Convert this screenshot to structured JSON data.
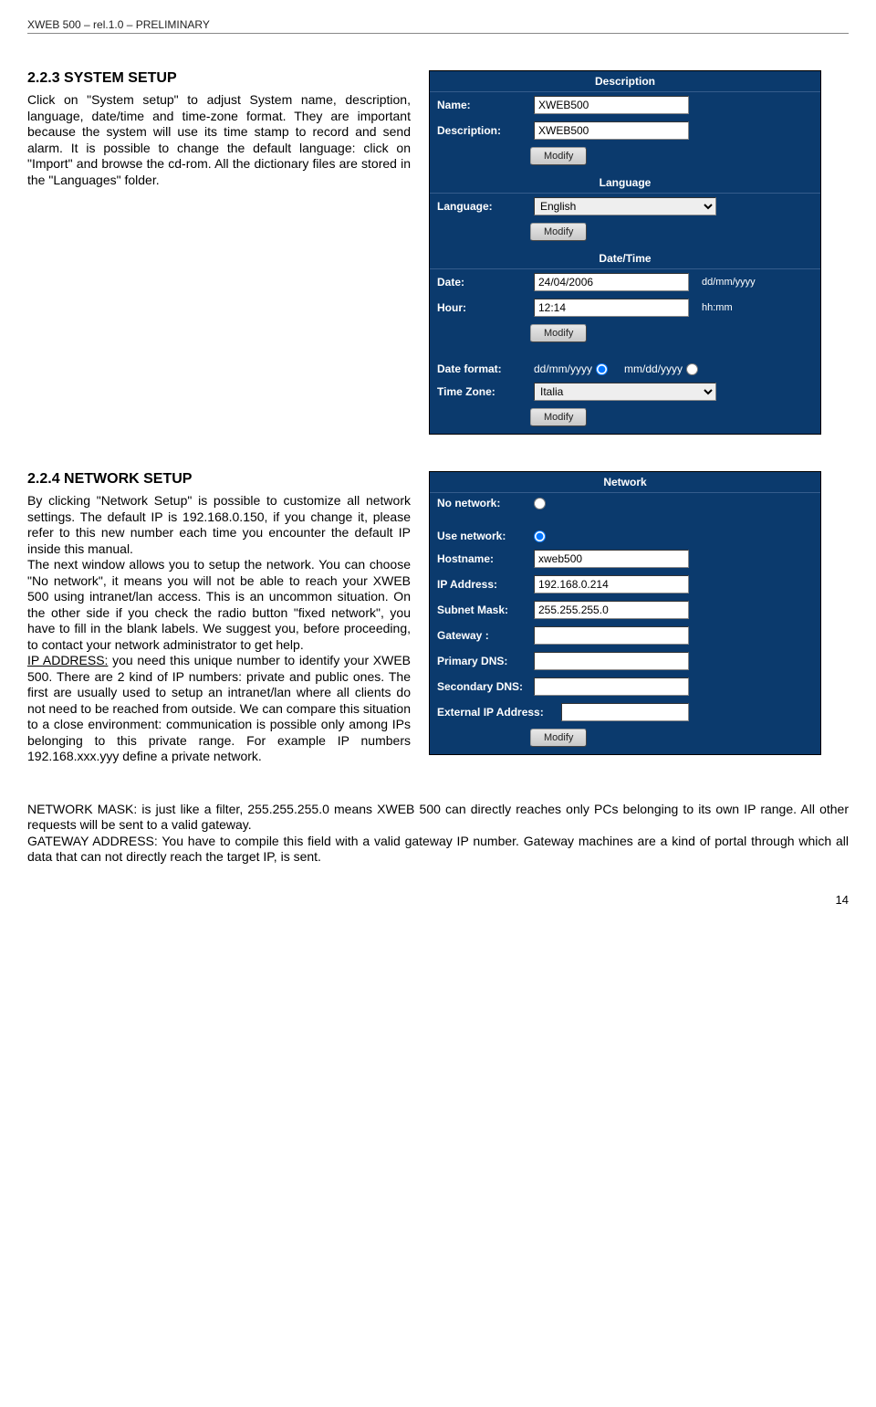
{
  "header": "XWEB 500 – rel.1.0 – PRELIMINARY",
  "page_num": "14",
  "section1": {
    "title": "2.2.3  SYSTEM SETUP",
    "body": "Click on \"System setup\" to adjust System name, description, language, date/time and time-zone format. They are important because the system will use its time stamp to record and send alarm. It is possible to change the default language: click on \"Import\" and browse the cd-rom. All the dictionary files are stored in the \"Languages\" folder."
  },
  "section2": {
    "title": "2.2.4  NETWORK SETUP",
    "body_p1": "By clicking \"Network Setup\" is possible to customize all network settings. The default IP is 192.168.0.150, if you change it, please refer to this new number each time you encounter the default IP inside this manual.",
    "body_p2": "The next window allows you to setup the network. You can choose \"No network\", it means you will not be able to reach your XWEB 500 using intranet/lan access. This is an uncommon situation. On the other side if you check the radio button \"fixed network\", you have to fill in the blank labels. We suggest you, before proceeding, to contact your network administrator to get help.",
    "body_p3a": "IP ADDRESS:",
    "body_p3b": " you need this unique number to identify your XWEB 500. There are 2 kind of IP numbers: private and public ones. The first are usually used to setup an intranet/lan where all clients do not need to be reached from outside. We can compare this situation to a close environment: communication is possible only among IPs belonging to this private range. For example IP numbers 192.168.xxx.yyy define a private network."
  },
  "bottom": {
    "nm_label": "NETWORK MASK:",
    "nm_text": " is just like a filter, 255.255.255.0 means XWEB 500 can directly reaches only PCs belonging to its own IP range. All other requests will be sent to a valid gateway.",
    "gw_label": "GATEWAY ADDRESS:",
    "gw_text": " You have to compile this field with a valid gateway IP number. Gateway machines are a kind of portal through which all data that can not directly reach the target IP, is sent."
  },
  "panel1": {
    "hdr_desc": "Description",
    "lbl_name": "Name:",
    "val_name": "XWEB500",
    "lbl_desc": "Description:",
    "val_desc": "XWEB500",
    "btn_modify": "Modify",
    "hdr_lang": "Language",
    "lbl_lang": "Language:",
    "val_lang": "English",
    "hdr_dt": "Date/Time",
    "lbl_date": "Date:",
    "val_date": "24/04/2006",
    "hint_date": "dd/mm/yyyy",
    "lbl_hour": "Hour:",
    "val_hour": "12:14",
    "hint_hour": "hh:mm",
    "lbl_datefmt": "Date format:",
    "opt_ddmm": "dd/mm/yyyy",
    "opt_mmdd": "mm/dd/yyyy",
    "lbl_tz": "Time Zone:",
    "val_tz": "Italia"
  },
  "panel2": {
    "hdr": "Network",
    "lbl_nonet": "No network:",
    "lbl_usenet": "Use network:",
    "lbl_host": "Hostname:",
    "val_host": "xweb500",
    "lbl_ip": "IP Address:",
    "val_ip": "192.168.0.214",
    "lbl_mask": "Subnet Mask:",
    "val_mask": "255.255.255.0",
    "lbl_gw": "Gateway :",
    "lbl_pdns": "Primary DNS:",
    "lbl_sdns": "Secondary DNS:",
    "lbl_ext": "External IP Address:",
    "btn_modify": "Modify"
  }
}
